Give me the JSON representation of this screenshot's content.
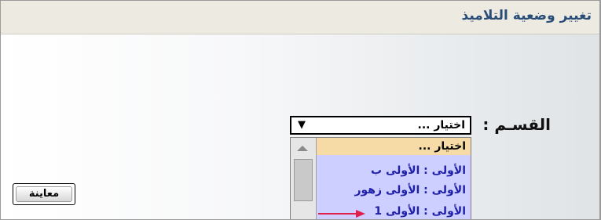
{
  "page": {
    "title": "تغيير وضعية التلاميذ"
  },
  "form": {
    "section_label": "القسـم :",
    "section_select": {
      "value": "اختيار ...",
      "options": [
        "اختيار ...",
        "الأولى : الأولى ب",
        "الأولى : الأولى زهور",
        "الأولى : الأولى 1"
      ]
    },
    "preview_button": "معاينة"
  },
  "colors": {
    "title_text": "#2a4d78",
    "title_bar": "#eceae1",
    "list_background": "#cccfff",
    "selected_option": "#f6dba6",
    "annotation_arrow": "#e0204a"
  }
}
